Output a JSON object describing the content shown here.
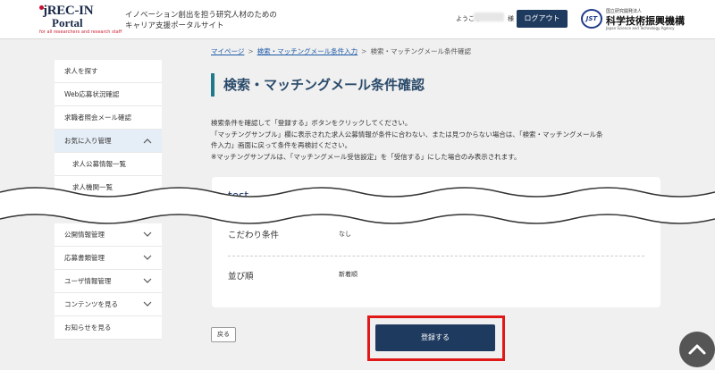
{
  "header": {
    "logo": {
      "line1": "jREC-IN",
      "line2": "Portal",
      "line3": "for all researchers and research staff"
    },
    "tagline": [
      "イノベーション創出を担う研究人材のための",
      "キャリア支援ポータルサイト"
    ],
    "welcome": "ようこそ",
    "honorific": "様",
    "logout_label": "ログアウト",
    "jst": {
      "badge": "JST",
      "top": "国立研究開発法人",
      "name": "科学技術振興機構",
      "en": "Japan Science and Technology Agency"
    }
  },
  "breadcrumb": {
    "items": [
      "マイページ",
      "検索・マッチングメール条件入力",
      "検索・マッチングメール条件確認"
    ],
    "separator": ">"
  },
  "page_title": "検索・マッチングメール条件確認",
  "sidebar": {
    "top_items": [
      {
        "label": "求人を探す"
      },
      {
        "label": "Web応募状況確認"
      },
      {
        "label": "求職者照会メール確認"
      },
      {
        "label": "お気に入り管理"
      },
      {
        "label": "求人公募情報一覧"
      },
      {
        "label": "求人機関一覧"
      }
    ],
    "bottom_items": [
      {
        "label": "公開情報管理"
      },
      {
        "label": "応募書類管理"
      },
      {
        "label": "ユーザ情報管理"
      },
      {
        "label": "コンテンツを見る"
      },
      {
        "label": "お知らせを見る"
      }
    ]
  },
  "description": [
    "検索条件を確認して「登録する」ボタンをクリックしてください。",
    "「マッチングサンプル」欄に表示された求人公募情報が条件に合わない、または見つからない場合は、「検索・マッチングメール条",
    "件入力」画面に戻って条件を再検討ください。",
    "※マッチングサンプルは、「マッチングメール受信設定」を「受信する」にした場合のみ表示されます。"
  ],
  "card": {
    "name": "test",
    "rows": [
      {
        "label": "こだわり条件",
        "value": "なし"
      },
      {
        "label": "並び順",
        "value": "新着順"
      }
    ]
  },
  "buttons": {
    "back_label": "戻る",
    "register_label": "登録する"
  },
  "colors": {
    "accent_navy": "#1e3a5f",
    "highlight_red": "#e01818",
    "title_bar": "#1e7a8c"
  }
}
